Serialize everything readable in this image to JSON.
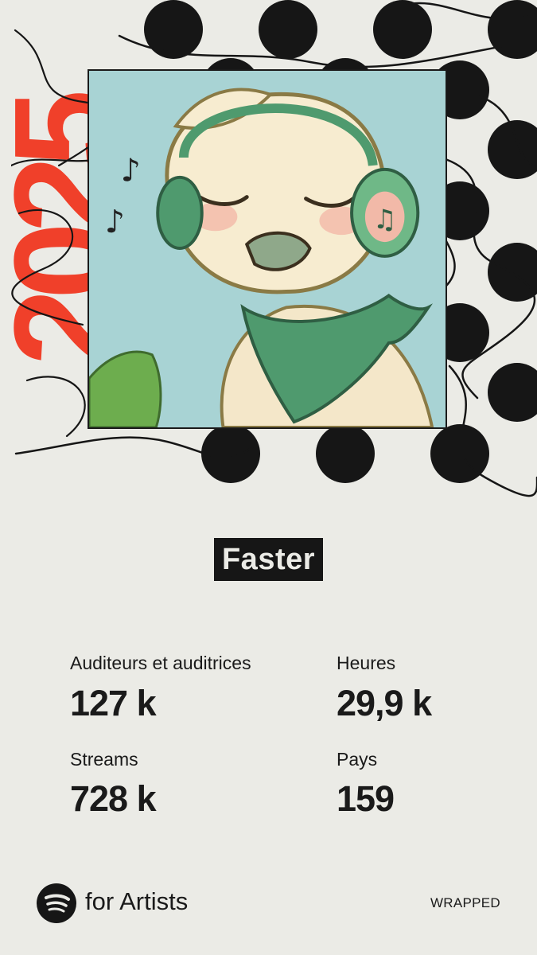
{
  "year": "2025",
  "track": {
    "title": "Faster"
  },
  "stats": [
    {
      "label": "Auditeurs et auditrices",
      "value": "127 k"
    },
    {
      "label": "Heures",
      "value": "29,9 k"
    },
    {
      "label": "Streams",
      "value": "728 k"
    },
    {
      "label": "Pays",
      "value": "159"
    }
  ],
  "footer": {
    "brand": "for Artists",
    "tag": "WRAPPED"
  },
  "colors": {
    "accent": "#f0402a",
    "dark": "#161616",
    "background": "#ebebe6"
  }
}
